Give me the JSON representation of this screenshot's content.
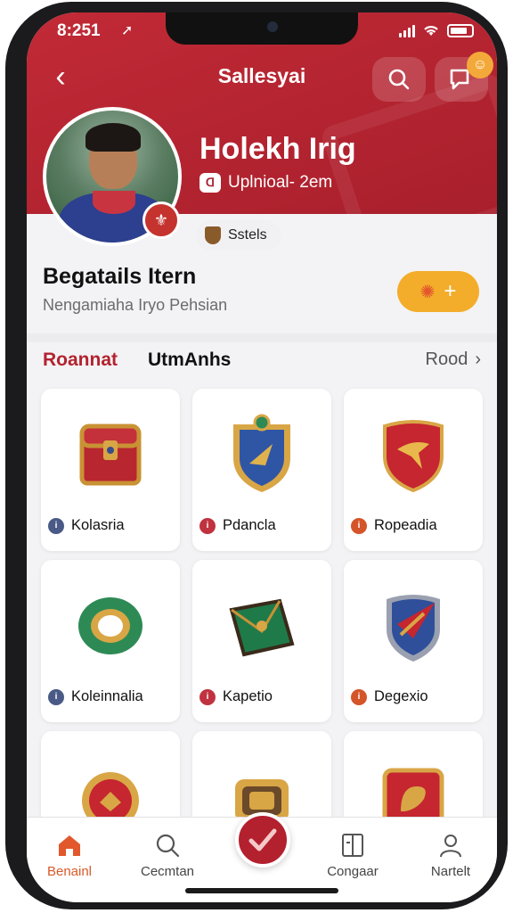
{
  "status_bar": {
    "time": "8:251",
    "time_icon": "➚"
  },
  "nav": {
    "title": "Sallesyai",
    "back_glyph": "‹"
  },
  "header_actions": {
    "search_icon": "search-icon",
    "chat_icon": "chat-icon",
    "chat_badge_icon": "smile-icon"
  },
  "profile": {
    "name": "Holekh Irig",
    "subtitle": "Uplnioal- 2em",
    "status_pill": "Sstels"
  },
  "details": {
    "title": "Begatails Itern",
    "subtitle": "Nengamiaha Iryo Pehsian",
    "add_glyph": "+"
  },
  "tabs": {
    "active": "Roannat",
    "second": "UtmAnhs",
    "see_all": "Rood",
    "see_all_glyph": "›"
  },
  "items": [
    {
      "label": "Kolasria",
      "dot_color": "#4a5a86",
      "art": "chest-icon"
    },
    {
      "label": "Pdancla",
      "dot_color": "#c0323f",
      "art": "crest-shield-icon"
    },
    {
      "label": "Ropeadia",
      "dot_color": "#d4552a",
      "art": "red-shield-icon"
    },
    {
      "label": "Koleinnalia",
      "dot_color": "#4a5a86",
      "art": "ring-icon"
    },
    {
      "label": "Kapetio",
      "dot_color": "#c0323f",
      "art": "wallet-icon"
    },
    {
      "label": "Degexio",
      "dot_color": "#d4552a",
      "art": "blue-shield-icon"
    },
    {
      "label": "",
      "dot_color": "#4a5a86",
      "art": "badge-icon"
    },
    {
      "label": "",
      "dot_color": "#c0323f",
      "art": "gauntlet-icon"
    },
    {
      "label": "",
      "dot_color": "#d4552a",
      "art": "emblem-icon"
    }
  ],
  "tabbar": {
    "items": [
      {
        "label": "Benainl",
        "icon": "home-icon"
      },
      {
        "label": "Cecmtan",
        "icon": "search-icon"
      },
      {
        "label": "",
        "icon": "check-icon"
      },
      {
        "label": "Congaar",
        "icon": "document-icon"
      },
      {
        "label": "Nartelt",
        "icon": "profile-icon"
      }
    ]
  },
  "colors": {
    "primary": "#b3232f",
    "accent": "#f3ad2b",
    "active_tab": "#d85a2a"
  }
}
